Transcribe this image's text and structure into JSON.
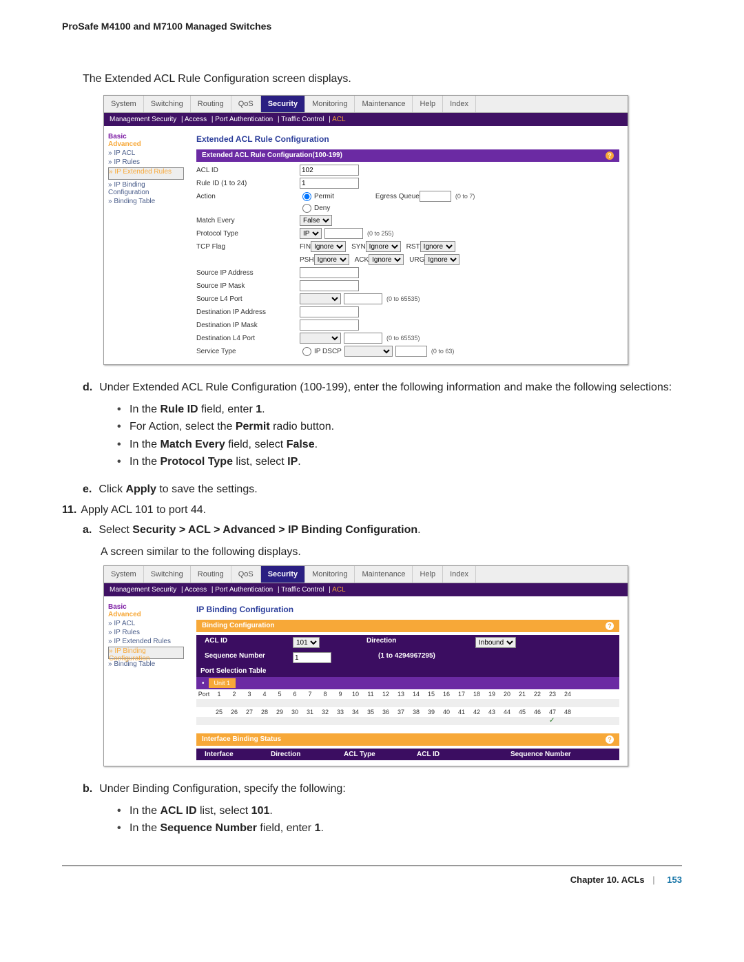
{
  "header": "ProSafe M4100 and M7100 Managed Switches",
  "intro": "The Extended ACL Rule Configuration screen displays.",
  "shot1": {
    "tabs": [
      "System",
      "Switching",
      "Routing",
      "QoS",
      "Security",
      "Monitoring",
      "Maintenance",
      "Help",
      "Index"
    ],
    "subnav": {
      "a": "Management Security",
      "b": "Access",
      "c": "Port Authentication",
      "d": "Traffic Control",
      "e": "ACL"
    },
    "side": {
      "basic": "Basic",
      "adv": "Advanced",
      "items": [
        "» IP ACL",
        "» IP Rules",
        "» IP Extended Rules",
        "» IP Binding Configuration",
        "» Binding Table"
      ],
      "sel": 2
    },
    "title": "Extended ACL Rule Configuration",
    "sect": "Extended ACL Rule Configuration(100-199)",
    "rows": {
      "aclid": {
        "l": "ACL ID",
        "v": "102"
      },
      "rule": {
        "l": "Rule ID (1 to 24)",
        "v": "1"
      },
      "action": {
        "l": "Action",
        "p": "Permit",
        "d": "Deny",
        "eg": "Egress Queue",
        "egn": "(0 to 7)"
      },
      "me": {
        "l": "Match Every",
        "v": "False"
      },
      "pt": {
        "l": "Protocol Type",
        "v": "IP",
        "n": "(0 to 255)"
      },
      "tcp": {
        "l": "TCP Flag",
        "f": [
          "FIN",
          "SYN",
          "RST",
          "PSH",
          "ACK",
          "URG"
        ],
        "ig": "Ignore"
      },
      "sip": {
        "l": "Source IP Address"
      },
      "sim": {
        "l": "Source IP Mask"
      },
      "slp": {
        "l": "Source L4 Port",
        "n": "(0 to 65535)"
      },
      "dip": {
        "l": "Destination IP Address"
      },
      "dim": {
        "l": "Destination IP Mask"
      },
      "dlp": {
        "l": "Destination L4 Port",
        "n": "(0 to 65535)"
      },
      "st": {
        "l": "Service Type",
        "v": "IP DSCP",
        "n": "(0 to 63)"
      }
    }
  },
  "instr_d": {
    "lead": "Under Extended ACL Rule Configuration (100-199), enter the following information and make the following selections:",
    "b1a": "In the ",
    "b1b": "Rule ID",
    "b1c": " field, enter ",
    "b1d": "1",
    "b1e": ".",
    "b2a": "For Action, select the ",
    "b2b": "Permit",
    "b2c": " radio button.",
    "b3a": "In the ",
    "b3b": "Match Every",
    "b3c": " field, select ",
    "b3d": "False",
    "b3e": ".",
    "b4a": "In the ",
    "b4b": "Protocol Type",
    "b4c": " list, select ",
    "b4d": "IP",
    "b4e": "."
  },
  "instr_e": {
    "a": "Click ",
    "b": "Apply",
    "c": " to save the settings."
  },
  "step11": "Apply ACL 101 to port 44.",
  "step11a": {
    "a": "Select ",
    "b": "Security > ACL > Advanced > IP Binding Configuration",
    "c": "."
  },
  "step11a2": "A screen similar to the following displays.",
  "shot2": {
    "title": "IP Binding Configuration",
    "sect1": "Binding Configuration",
    "aclid": {
      "l": "ACL ID",
      "v": "101"
    },
    "dir": {
      "l": "Direction",
      "v": "Inbound"
    },
    "seq": {
      "l": "Sequence Number",
      "v": "1",
      "n": "(1 to 4294967295)"
    },
    "pst": "Port Selection Table",
    "unit": "Unit 1",
    "p1": [
      "Port",
      "1",
      "2",
      "3",
      "4",
      "5",
      "6",
      "7",
      "8",
      "9",
      "10",
      "11",
      "12",
      "13",
      "14",
      "15",
      "16",
      "17",
      "18",
      "19",
      "20",
      "21",
      "22",
      "23",
      "24"
    ],
    "p2": [
      "",
      "25",
      "26",
      "27",
      "28",
      "29",
      "30",
      "31",
      "32",
      "33",
      "34",
      "35",
      "36",
      "37",
      "38",
      "39",
      "40",
      "41",
      "42",
      "43",
      "44",
      "45",
      "46",
      "47",
      "48"
    ],
    "ibs": "Interface Binding Status",
    "cols": [
      "Interface",
      "Direction",
      "ACL Type",
      "ACL ID",
      "Sequence Number"
    ]
  },
  "instr_b2": {
    "lead": "Under Binding Configuration, specify the following:",
    "i1a": "In the ",
    "i1b": "ACL ID",
    "i1c": " list, select ",
    "i1d": "101",
    "i1e": ".",
    "i2a": "In the ",
    "i2b": "Sequence Number",
    "i2c": " field, enter ",
    "i2d": "1",
    "i2e": "."
  },
  "footer": {
    "ch": "Chapter 10.  ACLs",
    "sep": "|",
    "pg": "153"
  }
}
